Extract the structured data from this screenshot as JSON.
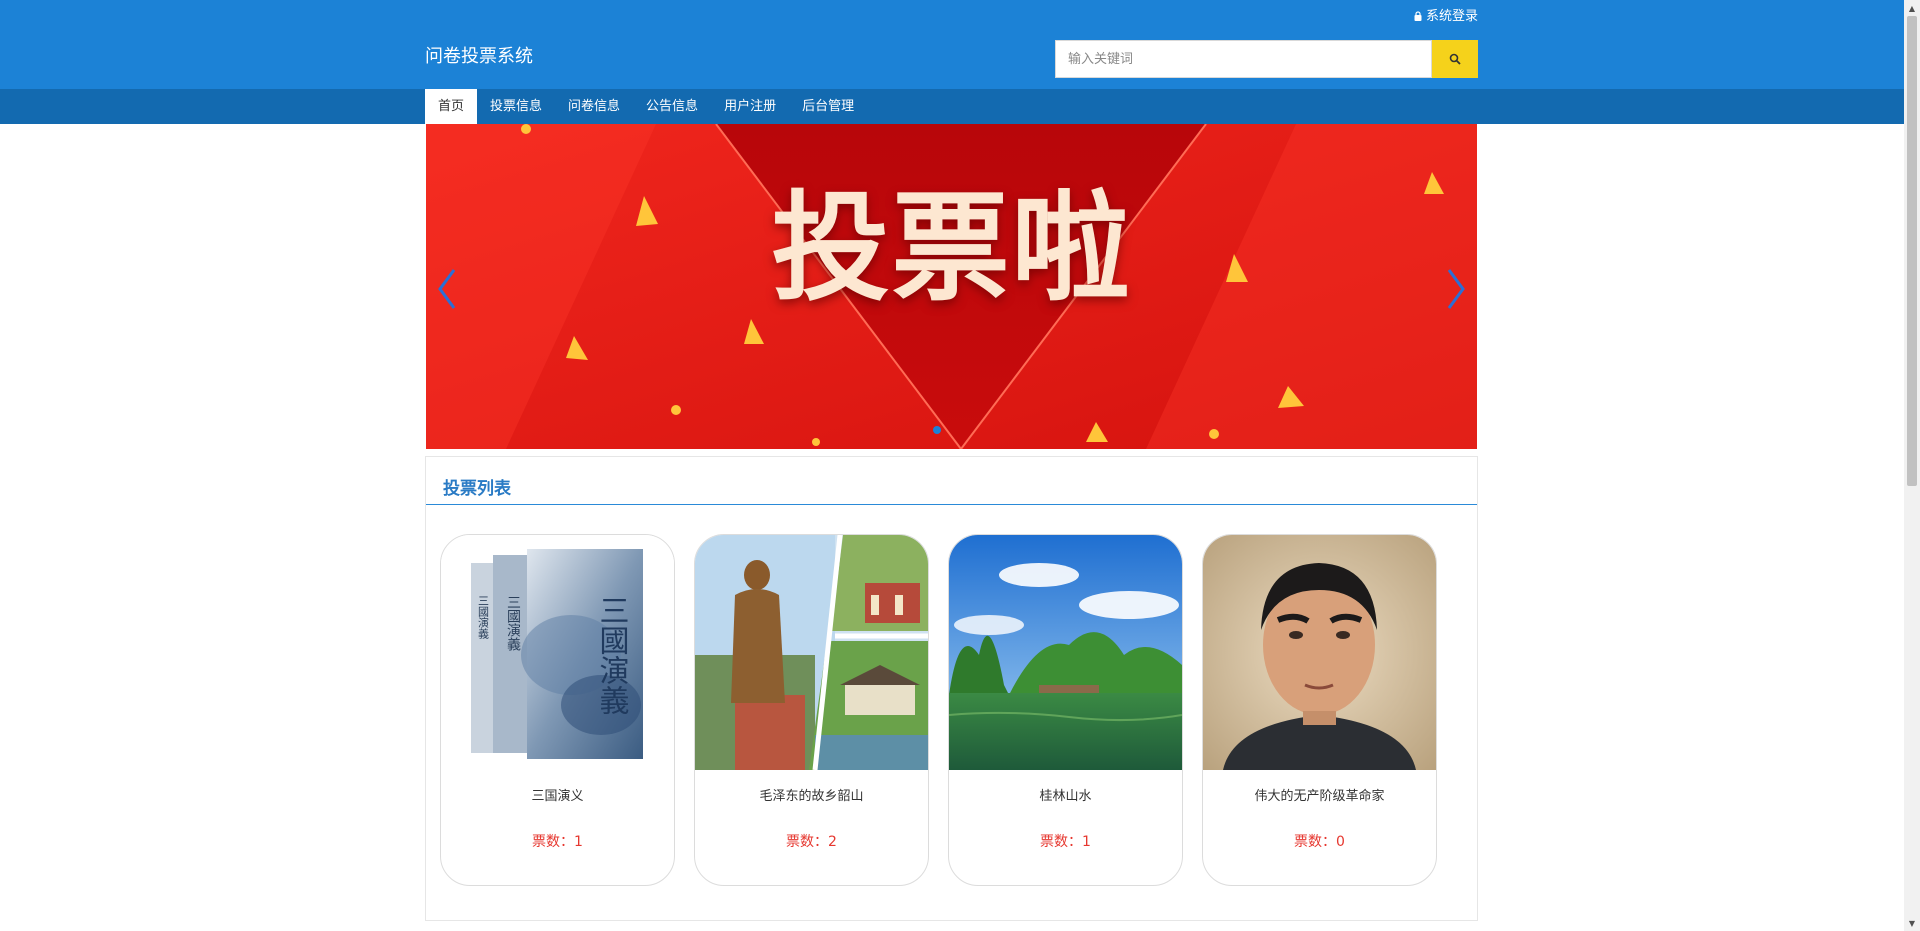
{
  "header": {
    "site_title": "问卷投票系统",
    "login_label": "系统登录",
    "search_placeholder": "输入关键词"
  },
  "nav": [
    {
      "label": "首页",
      "active": true
    },
    {
      "label": "投票信息"
    },
    {
      "label": "问卷信息"
    },
    {
      "label": "公告信息"
    },
    {
      "label": "用户注册"
    },
    {
      "label": "后台管理"
    }
  ],
  "banner": {
    "title": "投票啦",
    "slide_count": 1,
    "active_slide": 1
  },
  "section": {
    "title": "投票列表"
  },
  "cards": [
    {
      "name": "三国演义",
      "votes_label": "票数：1",
      "votes": 1,
      "image": "book-cover-image",
      "image_text": "三國演義"
    },
    {
      "name": "毛泽东的故乡韶山",
      "votes_label": "票数：2",
      "votes": 2,
      "image": "statue-collage-image"
    },
    {
      "name": "桂林山水",
      "votes_label": "票数：1",
      "votes": 1,
      "image": "landscape-image"
    },
    {
      "name": "伟大的无产阶级革命家",
      "votes_label": "票数：0",
      "votes": 0,
      "image": "portrait-image"
    }
  ],
  "colors": {
    "header_bg": "#1c82d6",
    "nav_bg": "#136ab0",
    "search_button": "#f5d21b",
    "vote_text": "#e6372f",
    "section_title": "#2a7bc5"
  }
}
